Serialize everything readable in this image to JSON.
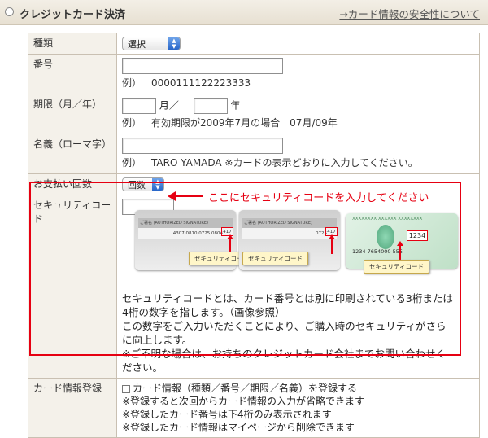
{
  "header": {
    "title": "クレジットカード決済",
    "link": "→カード情報の安全性について"
  },
  "rows": {
    "kind": {
      "label": "種類",
      "select": "選択"
    },
    "number": {
      "label": "番号",
      "example_prefix": "例）",
      "example": "0000111122223333"
    },
    "expiry": {
      "label": "期限（月／年）",
      "month_unit": "月／",
      "year_unit": "年",
      "example_prefix": "例）",
      "example": "有効期限が2009年7月の場合　07月/09年"
    },
    "holder": {
      "label": "名義（ローマ字）",
      "example_prefix": "例）",
      "example": "TARO YAMADA ※カードの表示どおりに入力してください。"
    },
    "installments": {
      "label": "お支払い回数",
      "select": "回数"
    },
    "security": {
      "label": "セキュリティコード",
      "hint": "ここにセキュリティコードを入力してください",
      "card1": {
        "sig": "ご署名 (AUTHORIZED SIGNATURE)",
        "number": "4307 0810 0725 0804",
        "code": "417",
        "callout": "セキュリティコード"
      },
      "card2": {
        "sig": "ご署名 (AUTHORIZED SIGNATURE)",
        "number": "0725",
        "code": "417",
        "callout": "セキュリティコード"
      },
      "card3": {
        "top": "XXXXXXXX XXXXXX XXXXXXXX",
        "code": "1234",
        "number": "1234   7654000     555",
        "callout": "セキュリティコード"
      },
      "description": [
        "セキュリティコードとは、カード番号とは別に印刷されている3桁または",
        "4桁の数字を指します。（画像参照）",
        "この数字をご入力いただくことにより、ご購入時のセキュリティがさら",
        "に向上します。",
        "※ご不明な場合は、お持ちのクレジットカード会社までお問い合わせく",
        "ださい。"
      ]
    },
    "register": {
      "label": "カード情報登録",
      "checkbox": "カード情報（種類／番号／期限／名義）を登録する",
      "notes": [
        "※登録すると次回からカード情報の入力が省略できます",
        "※登録したカード番号は下4桁のみ表示されます",
        "※登録したカード情報はマイページから削除できます"
      ]
    }
  },
  "colors": {
    "accent_red": "#e60012",
    "label_bg": "#f4f1ea",
    "border": "#c9c0b2"
  }
}
